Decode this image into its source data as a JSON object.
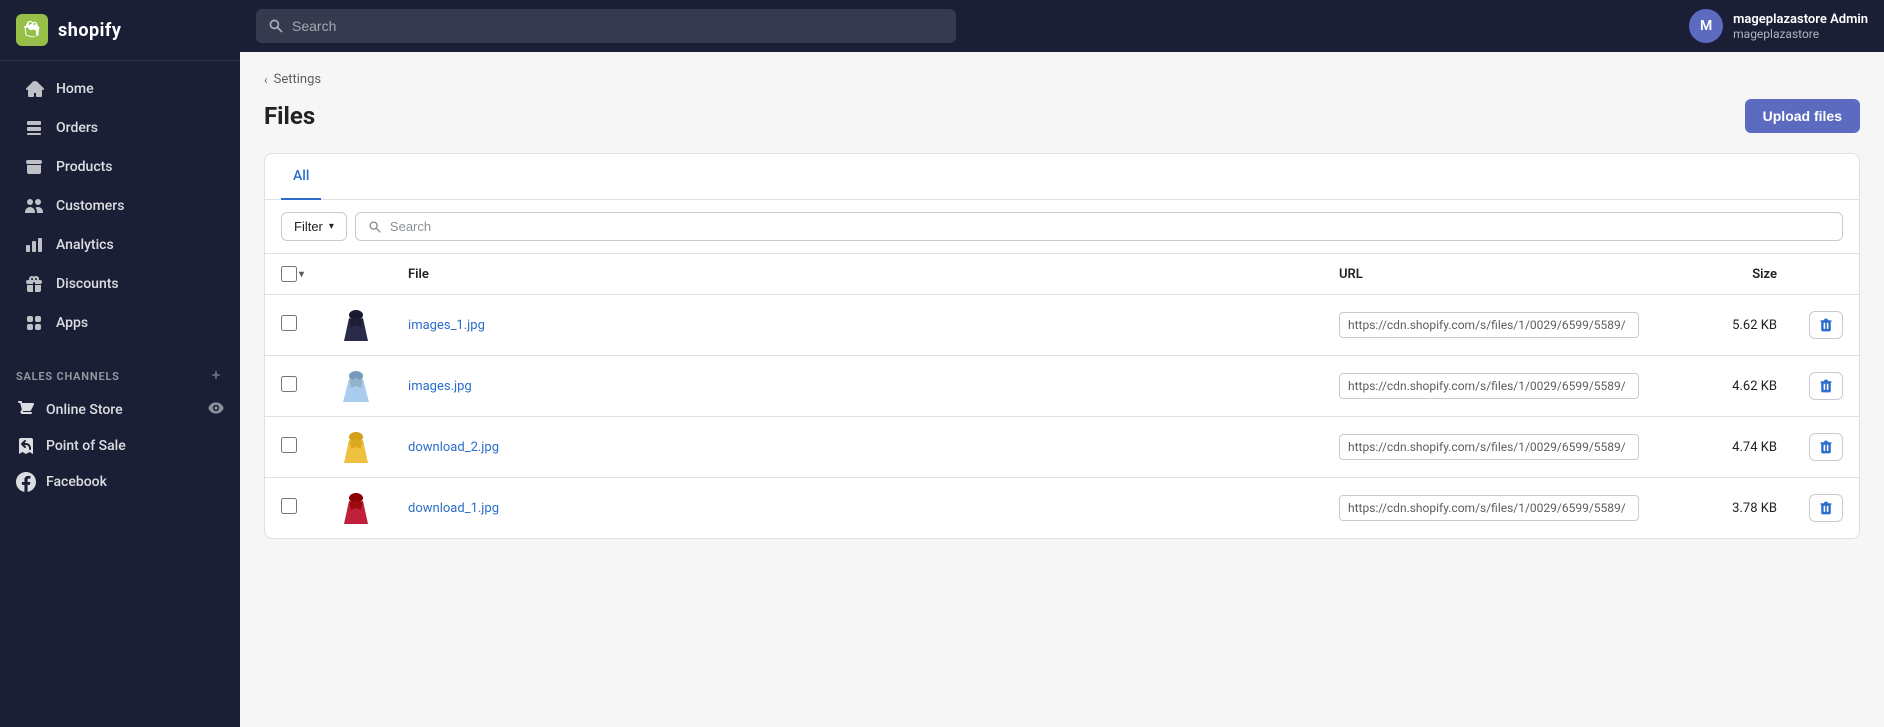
{
  "branding": {
    "logo_text": "shopify",
    "store_name": "mageplazastore Admin",
    "store_sub": "mageplazastore",
    "user_initials": "M"
  },
  "topbar": {
    "search_placeholder": "Search"
  },
  "sidebar": {
    "nav_items": [
      {
        "id": "home",
        "label": "Home",
        "icon": "home"
      },
      {
        "id": "orders",
        "label": "Orders",
        "icon": "orders"
      },
      {
        "id": "products",
        "label": "Products",
        "icon": "products"
      },
      {
        "id": "customers",
        "label": "Customers",
        "icon": "customers"
      },
      {
        "id": "analytics",
        "label": "Analytics",
        "icon": "analytics"
      },
      {
        "id": "discounts",
        "label": "Discounts",
        "icon": "discounts"
      },
      {
        "id": "apps",
        "label": "Apps",
        "icon": "apps"
      }
    ],
    "sales_channels_label": "SALES CHANNELS",
    "sales_channels": [
      {
        "id": "online-store",
        "label": "Online Store",
        "icon": "store"
      },
      {
        "id": "point-of-sale",
        "label": "Point of Sale",
        "icon": "pos"
      },
      {
        "id": "facebook",
        "label": "Facebook",
        "icon": "facebook"
      }
    ]
  },
  "breadcrumb": {
    "parent": "Settings",
    "chevron": "‹"
  },
  "page": {
    "title": "Files",
    "upload_btn": "Upload files"
  },
  "tabs": [
    {
      "id": "all",
      "label": "All",
      "active": true
    }
  ],
  "toolbar": {
    "filter_label": "Filter",
    "search_placeholder": "Search"
  },
  "table": {
    "columns": {
      "file": "File",
      "url": "URL",
      "size": "Size"
    },
    "rows": [
      {
        "id": 1,
        "filename": "images_1.jpg",
        "url": "https://cdn.shopify.com/s/files/1/0029/6599/5589/",
        "size": "5.62 KB",
        "color": "#2a2a4a",
        "thumb_type": "dark_dress"
      },
      {
        "id": 2,
        "filename": "images.jpg",
        "url": "https://cdn.shopify.com/s/files/1/0029/6599/5589/",
        "size": "4.62 KB",
        "color": "#b0c4de",
        "thumb_type": "light_dress"
      },
      {
        "id": 3,
        "filename": "download_2.jpg",
        "url": "https://cdn.shopify.com/s/files/1/0029/6599/5589/",
        "size": "4.74 KB",
        "color": "#f0c040",
        "thumb_type": "yellow_dress"
      },
      {
        "id": 4,
        "filename": "download_1.jpg",
        "url": "https://cdn.shopify.com/s/files/1/0029/6599/5589/",
        "size": "3.78 KB",
        "color": "#c0203a",
        "thumb_type": "red_dress"
      }
    ]
  }
}
